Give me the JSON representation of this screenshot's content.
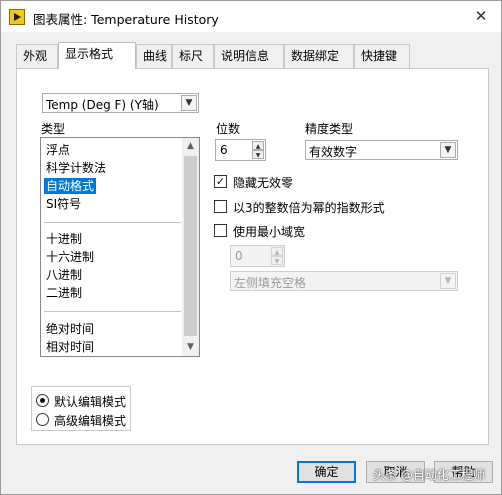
{
  "window": {
    "title": "图表属性: Temperature History",
    "close_glyph": "✕"
  },
  "tabs": [
    {
      "label": "外观"
    },
    {
      "label": "显示格式"
    },
    {
      "label": "曲线"
    },
    {
      "label": "标尺"
    },
    {
      "label": "说明信息"
    },
    {
      "label": "数据绑定"
    },
    {
      "label": "快捷键"
    }
  ],
  "active_tab": "显示格式",
  "axis_selector": {
    "value": "Temp (Deg F)  (Y轴)",
    "arrow": "▼"
  },
  "type_list": {
    "label": "类型",
    "items": [
      "浮点",
      "科学计数法",
      "自动格式",
      "SI符号",
      "十进制",
      "十六进制",
      "八进制",
      "二进制",
      "绝对时间",
      "相对时间"
    ],
    "selected": "自动格式",
    "scroll_up": "▲",
    "scroll_down": "▼"
  },
  "digits": {
    "label": "位数",
    "value": "6"
  },
  "precision": {
    "label": "精度类型",
    "value": "有效数字",
    "arrow": "▼"
  },
  "options": {
    "hide_trailing_zeros": {
      "label": "隐藏无效零",
      "checked": true,
      "mark": "✓"
    },
    "exponent_multiple_of_3": {
      "label": "以3的整数倍为幂的指数形式",
      "checked": false,
      "mark": ""
    },
    "use_min_field_width": {
      "label": "使用最小域宽",
      "checked": false,
      "mark": ""
    }
  },
  "min_width": {
    "value": "0"
  },
  "padding": {
    "value": "左侧填充空格",
    "arrow": "▼"
  },
  "edit_mode": {
    "default_label": "默认编辑模式",
    "advanced_label": "高级编辑模式",
    "selected": "default"
  },
  "buttons": {
    "ok": "确定",
    "cancel": "取消",
    "help": "帮助"
  },
  "watermark": "头条 @自动化工程师",
  "spin_up": "▲",
  "spin_down": "▼"
}
